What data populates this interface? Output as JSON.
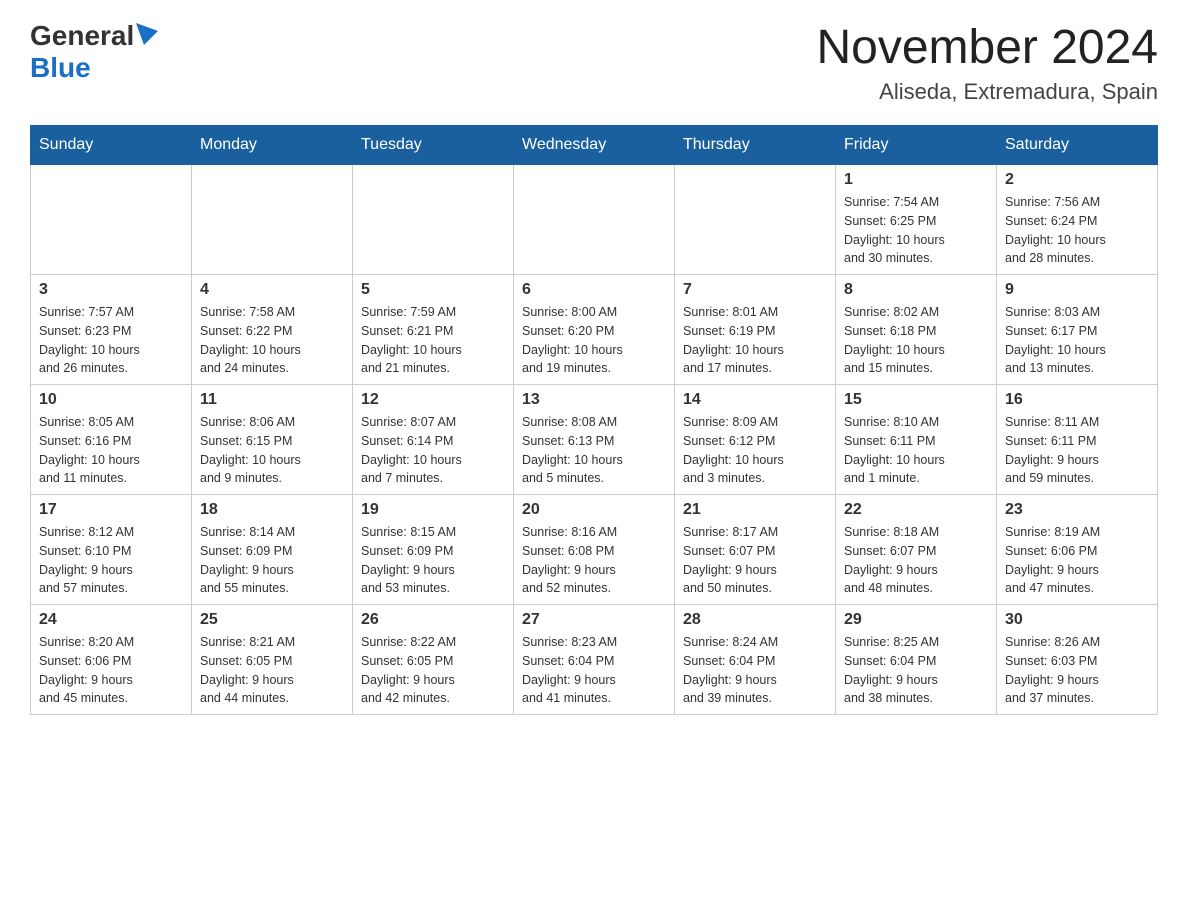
{
  "header": {
    "logo_general": "General",
    "logo_blue": "Blue",
    "month_title": "November 2024",
    "location": "Aliseda, Extremadura, Spain"
  },
  "weekdays": [
    "Sunday",
    "Monday",
    "Tuesday",
    "Wednesday",
    "Thursday",
    "Friday",
    "Saturday"
  ],
  "weeks": [
    [
      {
        "day": "",
        "info": ""
      },
      {
        "day": "",
        "info": ""
      },
      {
        "day": "",
        "info": ""
      },
      {
        "day": "",
        "info": ""
      },
      {
        "day": "",
        "info": ""
      },
      {
        "day": "1",
        "info": "Sunrise: 7:54 AM\nSunset: 6:25 PM\nDaylight: 10 hours\nand 30 minutes."
      },
      {
        "day": "2",
        "info": "Sunrise: 7:56 AM\nSunset: 6:24 PM\nDaylight: 10 hours\nand 28 minutes."
      }
    ],
    [
      {
        "day": "3",
        "info": "Sunrise: 7:57 AM\nSunset: 6:23 PM\nDaylight: 10 hours\nand 26 minutes."
      },
      {
        "day": "4",
        "info": "Sunrise: 7:58 AM\nSunset: 6:22 PM\nDaylight: 10 hours\nand 24 minutes."
      },
      {
        "day": "5",
        "info": "Sunrise: 7:59 AM\nSunset: 6:21 PM\nDaylight: 10 hours\nand 21 minutes."
      },
      {
        "day": "6",
        "info": "Sunrise: 8:00 AM\nSunset: 6:20 PM\nDaylight: 10 hours\nand 19 minutes."
      },
      {
        "day": "7",
        "info": "Sunrise: 8:01 AM\nSunset: 6:19 PM\nDaylight: 10 hours\nand 17 minutes."
      },
      {
        "day": "8",
        "info": "Sunrise: 8:02 AM\nSunset: 6:18 PM\nDaylight: 10 hours\nand 15 minutes."
      },
      {
        "day": "9",
        "info": "Sunrise: 8:03 AM\nSunset: 6:17 PM\nDaylight: 10 hours\nand 13 minutes."
      }
    ],
    [
      {
        "day": "10",
        "info": "Sunrise: 8:05 AM\nSunset: 6:16 PM\nDaylight: 10 hours\nand 11 minutes."
      },
      {
        "day": "11",
        "info": "Sunrise: 8:06 AM\nSunset: 6:15 PM\nDaylight: 10 hours\nand 9 minutes."
      },
      {
        "day": "12",
        "info": "Sunrise: 8:07 AM\nSunset: 6:14 PM\nDaylight: 10 hours\nand 7 minutes."
      },
      {
        "day": "13",
        "info": "Sunrise: 8:08 AM\nSunset: 6:13 PM\nDaylight: 10 hours\nand 5 minutes."
      },
      {
        "day": "14",
        "info": "Sunrise: 8:09 AM\nSunset: 6:12 PM\nDaylight: 10 hours\nand 3 minutes."
      },
      {
        "day": "15",
        "info": "Sunrise: 8:10 AM\nSunset: 6:11 PM\nDaylight: 10 hours\nand 1 minute."
      },
      {
        "day": "16",
        "info": "Sunrise: 8:11 AM\nSunset: 6:11 PM\nDaylight: 9 hours\nand 59 minutes."
      }
    ],
    [
      {
        "day": "17",
        "info": "Sunrise: 8:12 AM\nSunset: 6:10 PM\nDaylight: 9 hours\nand 57 minutes."
      },
      {
        "day": "18",
        "info": "Sunrise: 8:14 AM\nSunset: 6:09 PM\nDaylight: 9 hours\nand 55 minutes."
      },
      {
        "day": "19",
        "info": "Sunrise: 8:15 AM\nSunset: 6:09 PM\nDaylight: 9 hours\nand 53 minutes."
      },
      {
        "day": "20",
        "info": "Sunrise: 8:16 AM\nSunset: 6:08 PM\nDaylight: 9 hours\nand 52 minutes."
      },
      {
        "day": "21",
        "info": "Sunrise: 8:17 AM\nSunset: 6:07 PM\nDaylight: 9 hours\nand 50 minutes."
      },
      {
        "day": "22",
        "info": "Sunrise: 8:18 AM\nSunset: 6:07 PM\nDaylight: 9 hours\nand 48 minutes."
      },
      {
        "day": "23",
        "info": "Sunrise: 8:19 AM\nSunset: 6:06 PM\nDaylight: 9 hours\nand 47 minutes."
      }
    ],
    [
      {
        "day": "24",
        "info": "Sunrise: 8:20 AM\nSunset: 6:06 PM\nDaylight: 9 hours\nand 45 minutes."
      },
      {
        "day": "25",
        "info": "Sunrise: 8:21 AM\nSunset: 6:05 PM\nDaylight: 9 hours\nand 44 minutes."
      },
      {
        "day": "26",
        "info": "Sunrise: 8:22 AM\nSunset: 6:05 PM\nDaylight: 9 hours\nand 42 minutes."
      },
      {
        "day": "27",
        "info": "Sunrise: 8:23 AM\nSunset: 6:04 PM\nDaylight: 9 hours\nand 41 minutes."
      },
      {
        "day": "28",
        "info": "Sunrise: 8:24 AM\nSunset: 6:04 PM\nDaylight: 9 hours\nand 39 minutes."
      },
      {
        "day": "29",
        "info": "Sunrise: 8:25 AM\nSunset: 6:04 PM\nDaylight: 9 hours\nand 38 minutes."
      },
      {
        "day": "30",
        "info": "Sunrise: 8:26 AM\nSunset: 6:03 PM\nDaylight: 9 hours\nand 37 minutes."
      }
    ]
  ]
}
